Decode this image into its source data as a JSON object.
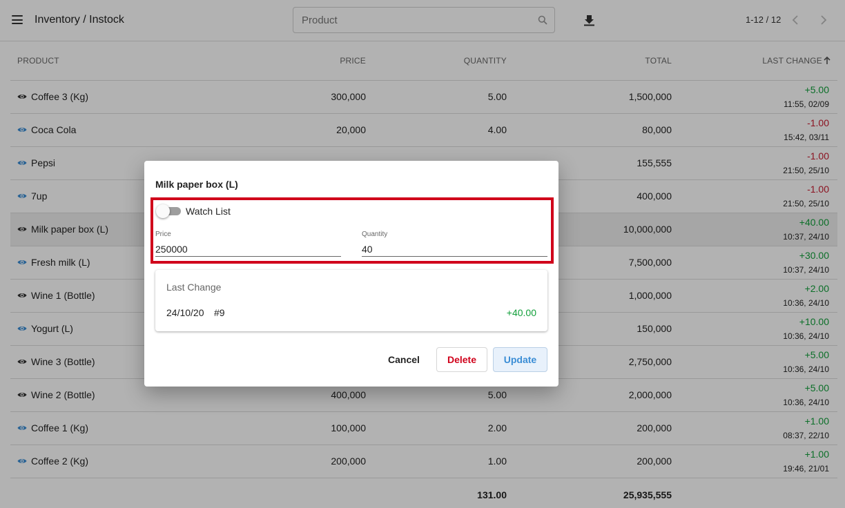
{
  "header": {
    "title": "Inventory / Instock",
    "search_placeholder": "Product",
    "pagination": "1-12 / 12"
  },
  "table": {
    "columns": [
      "PRODUCT",
      "PRICE",
      "QUANTITY",
      "TOTAL",
      "LAST CHANGE"
    ],
    "rows": [
      {
        "name": "Coffee 3 (Kg)",
        "price": "300,000",
        "qty": "5.00",
        "total": "1,500,000",
        "delta": "+5.00",
        "time": "11:55, 02/09",
        "watch": true
      },
      {
        "name": "Coca Cola",
        "price": "20,000",
        "qty": "4.00",
        "total": "80,000",
        "delta": "-1.00",
        "time": "15:42, 03/11",
        "watch": false
      },
      {
        "name": "Pepsi",
        "price": "",
        "qty": "",
        "total": "155,555",
        "delta": "-1.00",
        "time": "21:50, 25/10",
        "watch": false
      },
      {
        "name": "7up",
        "price": "",
        "qty": "",
        "total": "400,000",
        "delta": "-1.00",
        "time": "21:50, 25/10",
        "watch": false
      },
      {
        "name": "Milk paper box (L)",
        "price": "",
        "qty": "",
        "total": "10,000,000",
        "delta": "+40.00",
        "time": "10:37, 24/10",
        "watch": true
      },
      {
        "name": "Fresh milk (L)",
        "price": "",
        "qty": "",
        "total": "7,500,000",
        "delta": "+30.00",
        "time": "10:37, 24/10",
        "watch": false
      },
      {
        "name": "Wine 1 (Bottle)",
        "price": "",
        "qty": "",
        "total": "1,000,000",
        "delta": "+2.00",
        "time": "10:36, 24/10",
        "watch": true
      },
      {
        "name": "Yogurt (L)",
        "price": "",
        "qty": "",
        "total": "150,000",
        "delta": "+10.00",
        "time": "10:36, 24/10",
        "watch": false
      },
      {
        "name": "Wine 3 (Bottle)",
        "price": "",
        "qty": "",
        "total": "2,750,000",
        "delta": "+5.00",
        "time": "10:36, 24/10",
        "watch": true
      },
      {
        "name": "Wine 2 (Bottle)",
        "price": "400,000",
        "qty": "5.00",
        "total": "2,000,000",
        "delta": "+5.00",
        "time": "10:36, 24/10",
        "watch": true
      },
      {
        "name": "Coffee 1 (Kg)",
        "price": "100,000",
        "qty": "2.00",
        "total": "200,000",
        "delta": "+1.00",
        "time": "08:37, 22/10",
        "watch": false
      },
      {
        "name": "Coffee 2 (Kg)",
        "price": "200,000",
        "qty": "1.00",
        "total": "200,000",
        "delta": "+1.00",
        "time": "19:46, 21/01",
        "watch": false
      }
    ],
    "totals": {
      "qty": "131.00",
      "total": "25,935,555"
    }
  },
  "dialog": {
    "title": "Milk paper box (L)",
    "watch_list_label": "Watch List",
    "price_label": "Price",
    "price_value": "250000",
    "quantity_label": "Quantity",
    "quantity_value": "40",
    "last_change_title": "Last Change",
    "last_change_date": "24/10/20",
    "last_change_id": "#9",
    "last_change_delta": "+40.00",
    "cancel_label": "Cancel",
    "delete_label": "Delete",
    "update_label": "Update"
  },
  "colors": {
    "positive": "#119f3a",
    "negative": "#c81a2e",
    "watch_icon": "#3a8dd5",
    "highlight_frame": "#d0021b"
  }
}
